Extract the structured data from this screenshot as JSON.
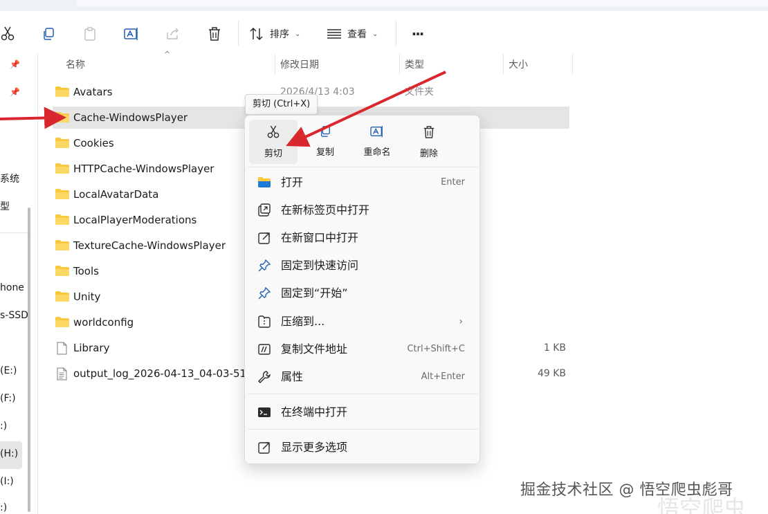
{
  "toolbar": {
    "cut_icon": "scissors-icon",
    "copy_icon": "copy-icon",
    "paste_icon": "paste-icon",
    "rename_icon": "rename-icon",
    "share_icon": "share-icon",
    "delete_icon": "trash-icon",
    "sort_label": "排序",
    "view_label": "查看",
    "more_label": "···"
  },
  "nav": {
    "items": [
      "系统",
      "型",
      "hone",
      "s-SSD",
      "(E:)",
      "(F:)",
      ":)",
      "(H:)",
      "(I:)",
      ":)"
    ]
  },
  "columns": {
    "name": "名称",
    "modified": "修改日期",
    "type": "类型",
    "size": "大小"
  },
  "files": [
    {
      "name": "Avatars",
      "date": "2026/4/13 4:03",
      "type": "文件夹",
      "size": "",
      "kind": "folder"
    },
    {
      "name": "Cache-WindowsPlayer",
      "date": "",
      "type": "",
      "size": "",
      "kind": "folder"
    },
    {
      "name": "Cookies",
      "date": "",
      "type": "",
      "size": "",
      "kind": "folder"
    },
    {
      "name": "HTTPCache-WindowsPlayer",
      "date": "",
      "type": "",
      "size": "",
      "kind": "folder"
    },
    {
      "name": "LocalAvatarData",
      "date": "",
      "type": "",
      "size": "",
      "kind": "folder"
    },
    {
      "name": "LocalPlayerModerations",
      "date": "",
      "type": "",
      "size": "",
      "kind": "folder"
    },
    {
      "name": "TextureCache-WindowsPlayer",
      "date": "",
      "type": "",
      "size": "",
      "kind": "folder"
    },
    {
      "name": "Tools",
      "date": "",
      "type": "",
      "size": "",
      "kind": "folder"
    },
    {
      "name": "Unity",
      "date": "",
      "type": "",
      "size": "",
      "kind": "folder"
    },
    {
      "name": "worldconfig",
      "date": "",
      "type": "",
      "size": "",
      "kind": "folder"
    },
    {
      "name": "Library",
      "date": "",
      "type": "",
      "size": "1 KB",
      "kind": "file"
    },
    {
      "name": "output_log_2026-04-13_04-03-51",
      "date": "",
      "type": "",
      "size": "49 KB",
      "kind": "file"
    }
  ],
  "tooltip": "剪切 (Ctrl+X)",
  "context_menu": {
    "quick_actions": [
      {
        "label": "剪切",
        "icon": "scissors-icon"
      },
      {
        "label": "复制",
        "icon": "copy-icon"
      },
      {
        "label": "重命名",
        "icon": "rename-icon"
      },
      {
        "label": "删除",
        "icon": "trash-icon"
      }
    ],
    "items": [
      {
        "label": "打开",
        "shortcut": "Enter",
        "icon": "folder-icon"
      },
      {
        "label": "在新标签页中打开",
        "shortcut": "",
        "icon": "new-tab-icon"
      },
      {
        "label": "在新窗口中打开",
        "shortcut": "",
        "icon": "new-window-icon"
      },
      {
        "label": "固定到快速访问",
        "shortcut": "",
        "icon": "pin-icon"
      },
      {
        "label": "固定到“开始”",
        "shortcut": "",
        "icon": "pin-icon"
      },
      {
        "label": "压缩到...",
        "shortcut": "",
        "icon": "archive-icon"
      },
      {
        "label": "复制文件地址",
        "shortcut": "Ctrl+Shift+C",
        "icon": "copy-path-icon"
      },
      {
        "label": "属性",
        "shortcut": "Alt+Enter",
        "icon": "wrench-icon"
      },
      {
        "label": "在终端中打开",
        "shortcut": "",
        "icon": "terminal-icon"
      },
      {
        "label": "显示更多选项",
        "shortcut": "",
        "icon": "more-options-icon"
      }
    ]
  },
  "watermark": "掘金技术社区 @ 悟空爬虫彪哥",
  "watermark_ghost": "悟空爬虫",
  "colors": {
    "accent": "#0067c0",
    "folder": "#f8c93e",
    "arrow": "#d9272e"
  }
}
